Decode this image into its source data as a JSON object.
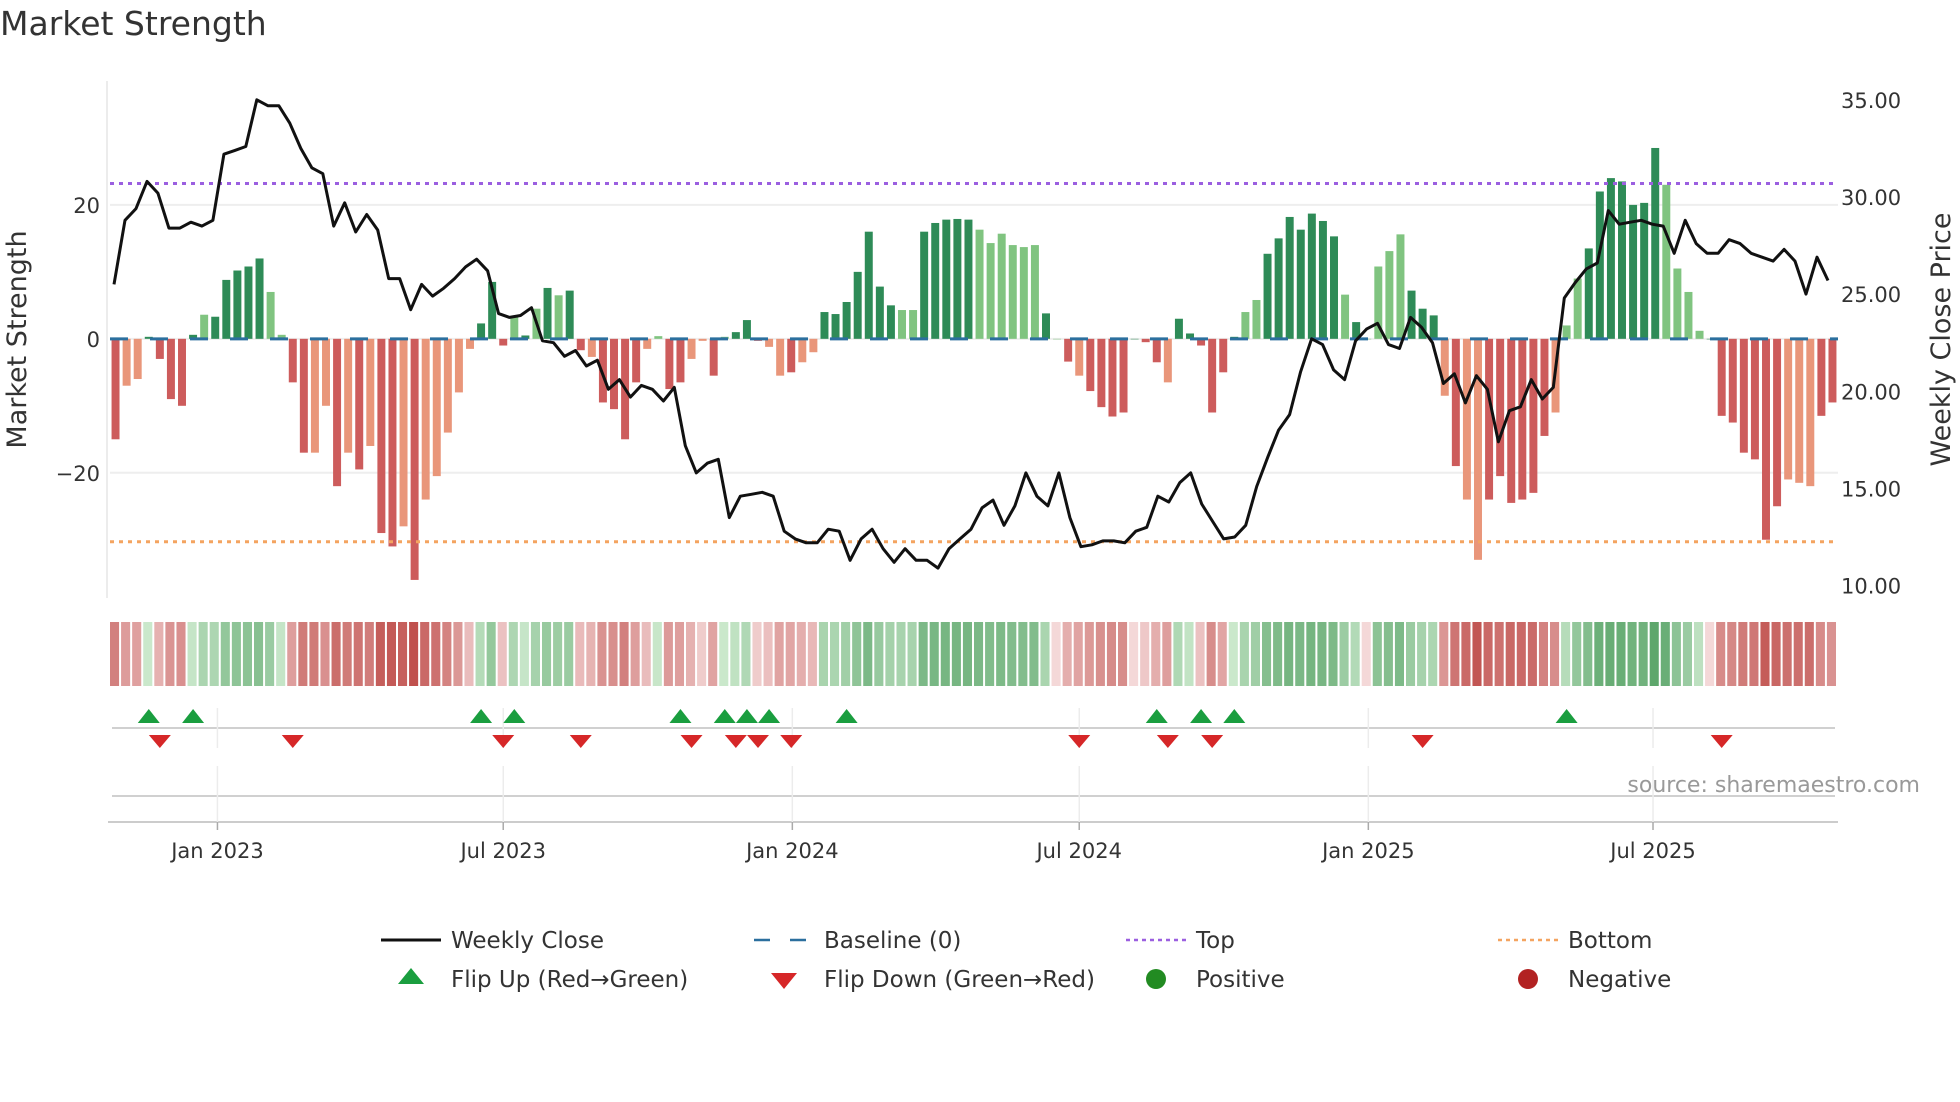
{
  "title": "Market Strength",
  "source": "source: sharemaestro.com",
  "colors": {
    "dark_green": "#2e8b57",
    "light_green": "#80c480",
    "dark_red": "#cd5c5c",
    "light_red": "#e9967a",
    "baseline": "#2b6f9e",
    "top": "#9b5fe0",
    "bottom": "#f4a460",
    "price": "#111111",
    "flip_up": "#1a9e3f",
    "flip_down": "#d62728",
    "heat_pos_lo": "#d6efd6",
    "heat_pos_hi": "#4f9e5f",
    "heat_neg_lo": "#f4d8d8",
    "heat_neg_hi": "#c0504d"
  },
  "chart_data": {
    "type": "bar",
    "title": "Market Strength",
    "ylabel": "Market Strength",
    "y2label": "Weekly Close Price",
    "ylim": [
      -38.7,
      38.5
    ],
    "y2lim": [
      9.36,
      35.97
    ],
    "yticks": [
      {
        "v": 20,
        "label": "20"
      },
      {
        "v": 0,
        "label": "0"
      },
      {
        "v": -20,
        "label": "−20"
      }
    ],
    "y2ticks": [
      {
        "v": 35,
        "label": "35.00"
      },
      {
        "v": 30,
        "label": "30.00"
      },
      {
        "v": 25,
        "label": "25.00"
      },
      {
        "v": 20,
        "label": "20.00"
      },
      {
        "v": 15,
        "label": "15.00"
      },
      {
        "v": 10,
        "label": "10.00"
      }
    ],
    "top_level": 23.2,
    "bottom_level": -30.3,
    "xticks": [
      {
        "week": 9.2,
        "label": "Jan 2023"
      },
      {
        "week": 35.0,
        "label": "Jul 2023"
      },
      {
        "week": 61.1,
        "label": "Jan 2024"
      },
      {
        "week": 87.0,
        "label": "Jul 2024"
      },
      {
        "week": 113.1,
        "label": "Jan 2025"
      },
      {
        "week": 138.8,
        "label": "Jul 2025"
      }
    ],
    "strength": [
      -15,
      -7,
      -6,
      0.3,
      -3,
      -9,
      -10,
      0.6,
      3.6,
      3.3,
      8.8,
      10.2,
      10.8,
      12,
      7,
      0.6,
      -6.5,
      -17,
      -17,
      -10,
      -22,
      -17,
      -19.5,
      -16,
      -29,
      -31,
      -28,
      -36,
      -24,
      -20.5,
      -14,
      -8,
      -1.5,
      2.3,
      8.5,
      -1,
      3.3,
      0.5,
      4.5,
      7.6,
      6.5,
      7.2,
      -1.7,
      -2.7,
      -9.5,
      -10.5,
      -15,
      -6.5,
      -1.5,
      0.4,
      -7.5,
      -6.5,
      -3,
      -0.3,
      -5.5,
      0.3,
      1,
      2.8,
      -0.3,
      -1.2,
      -5.5,
      -5,
      -3.5,
      -2,
      4,
      3.7,
      5.5,
      10,
      16,
      7.8,
      5,
      4.3,
      4.3,
      16,
      17.3,
      17.8,
      17.9,
      17.8,
      16.3,
      14.3,
      15.7,
      14,
      13.7,
      14,
      3.8,
      0,
      -3.4,
      -5.5,
      -7.8,
      -10.2,
      -11.6,
      -11,
      0,
      -0.5,
      -3.5,
      -6.5,
      3,
      0.8,
      -1,
      -11,
      -5,
      0.3,
      4,
      5.8,
      12.7,
      15,
      18.2,
      16.3,
      18.7,
      17.6,
      15.3,
      6.6,
      2.5,
      0,
      10.8,
      13.1,
      15.6,
      7.2,
      4.5,
      3.5,
      -8.5,
      -19,
      -24,
      -33,
      -24,
      -20.5,
      -24.5,
      -24,
      -23,
      -14.5,
      -11,
      2,
      9,
      13.5,
      22,
      24,
      23.5,
      20,
      20.3,
      28.5,
      23,
      10.5,
      7,
      1.2,
      0,
      -11.5,
      -12.5,
      -17,
      -18,
      -30,
      -25,
      -21,
      -21.5,
      -22,
      -11.5,
      -9.5
    ],
    "shade": "dlldddddldddddllddlldldlddldllllldddldldlddlddddllddlldldddlldlldddddddlldddddlllllldldldddddddlddddddlldddddddldlllldddldllddddddllldddddddlllldddddddlllddldddddllldll",
    "weekly_close": [
      25.5,
      28.8,
      29.4,
      30.8,
      30.2,
      28.4,
      28.4,
      28.7,
      28.5,
      28.8,
      32.2,
      32.4,
      32.6,
      35,
      34.7,
      34.7,
      33.8,
      32.5,
      31.5,
      31.2,
      28.5,
      29.7,
      28.2,
      29.1,
      28.3,
      25.8,
      25.8,
      24.2,
      25.5,
      24.9,
      25.3,
      25.8,
      26.4,
      26.8,
      26.2,
      24.0,
      23.8,
      23.9,
      24.3,
      22.6,
      22.5,
      21.8,
      22.1,
      21.3,
      21.6,
      20.1,
      20.6,
      19.7,
      20.3,
      20.1,
      19.5,
      20.2,
      17.2,
      15.8,
      16.3,
      16.5,
      13.5,
      14.6,
      14.7,
      14.8,
      14.6,
      12.8,
      12.4,
      12.2,
      12.2,
      12.9,
      12.8,
      11.3,
      12.4,
      12.9,
      11.9,
      11.2,
      11.9,
      11.3,
      11.3,
      10.9,
      11.9,
      12.4,
      12.9,
      14.0,
      14.4,
      13.1,
      14.1,
      15.8,
      14.6,
      14.1,
      15.8,
      13.5,
      12.0,
      12.1,
      12.3,
      12.3,
      12.2,
      12.8,
      13.0,
      14.6,
      14.3,
      15.3,
      15.8,
      14.2,
      13.3,
      12.4,
      12.5,
      13.1,
      15.1,
      16.6,
      18.0,
      18.8,
      21.0,
      22.7,
      22.4,
      21.1,
      20.6,
      22.6,
      23.2,
      23.5,
      22.4,
      22.2,
      23.8,
      23.3,
      22.5,
      20.4,
      20.9,
      19.4,
      20.8,
      20.1,
      17.4,
      19.0,
      19.2,
      20.6,
      19.6,
      20.2,
      24.8,
      25.6,
      26.3,
      26.6,
      29.3,
      28.6,
      28.7,
      28.8,
      28.6,
      28.5,
      27.1,
      28.8,
      27.6,
      27.1,
      27.1,
      27.8,
      27.6,
      27.1,
      26.9,
      26.7,
      27.3,
      26.7,
      25.0,
      26.9,
      25.7
    ],
    "flip_up_weeks": [
      3,
      7,
      33,
      36,
      51,
      55,
      57,
      59,
      66,
      94,
      98,
      101,
      131
    ],
    "flip_down_weeks": [
      4,
      16,
      35,
      42,
      52,
      56,
      58,
      61,
      87,
      95,
      99,
      118,
      145
    ]
  },
  "legend": [
    {
      "label": "Weekly Close",
      "kind": "line"
    },
    {
      "label": "Baseline (0)",
      "kind": "dash"
    },
    {
      "label": "Top",
      "kind": "dot-top"
    },
    {
      "label": "Bottom",
      "kind": "dot-bottom"
    },
    {
      "label": "Flip Up (Red→Green)",
      "kind": "tri-up"
    },
    {
      "label": "Flip Down (Green→Red)",
      "kind": "tri-down"
    },
    {
      "label": "Positive",
      "kind": "dot-pos"
    },
    {
      "label": "Negative",
      "kind": "dot-neg"
    }
  ],
  "legend_point_colors": {
    "positive": "#228b22",
    "negative": "#b22222"
  }
}
